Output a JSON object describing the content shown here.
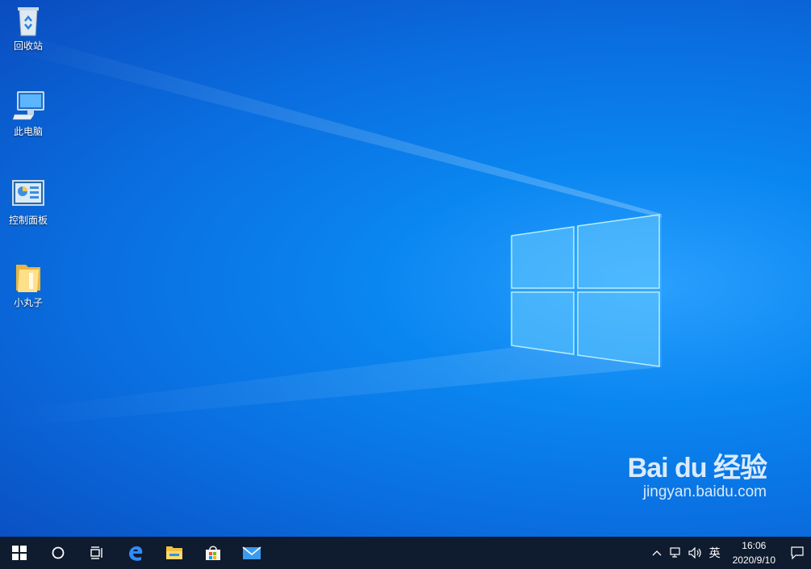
{
  "desktop": {
    "icons": [
      {
        "label": "回收站"
      },
      {
        "label": "此电脑"
      },
      {
        "label": "控制面板"
      },
      {
        "label": "小丸子"
      }
    ]
  },
  "watermark": {
    "brand": "Bai du 经验",
    "url": "jingyan.baidu.com"
  },
  "taskbar": {
    "pinned": [
      "start-icon",
      "search-icon",
      "task-view-icon",
      "edge-icon",
      "file-explorer-icon",
      "store-icon",
      "mail-icon"
    ],
    "tray": {
      "input_language": "英",
      "time": "16:06",
      "date": "2020/9/10"
    }
  }
}
